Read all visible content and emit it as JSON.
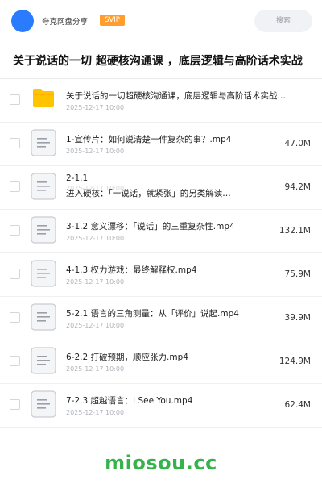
{
  "header": {
    "uploader": "夸克网盘分享",
    "badge": "SVIP",
    "search_placeholder": "搜索",
    "avatar_color": "#2b7bff"
  },
  "title": "关于说话的一切 超硬核沟通课 ，底层逻辑与高阶话术实战",
  "items": [
    {
      "type": "folder",
      "name": "关于说话的一切超硬核沟通课，底层逻辑与高阶话术实战…",
      "date": "2025-12-17 10:00",
      "size": ""
    },
    {
      "type": "file",
      "name": "1-宣传片：如何说清楚一件复杂的事？.mp4",
      "date": "2025-12-17 10:00",
      "size": "47.0M"
    },
    {
      "type": "file",
      "name": "2-1.1",
      "desc": "进入硬核：「一说话，就紧张」的另类解读…",
      "date": "2025-12-17 10:00",
      "size": "94.2M"
    },
    {
      "type": "file",
      "name": "3-1.2 意义漂移：「说话」的三重复杂性.mp4",
      "date": "2025-12-17 10:00",
      "size": "132.1M"
    },
    {
      "type": "file",
      "name": "4-1.3 权力游戏：最终解释权.mp4",
      "date": "2025-12-17 10:00",
      "size": "75.9M"
    },
    {
      "type": "file",
      "name": "5-2.1 语言的三角测量：从「评价」说起.mp4",
      "date": "2025-12-17 10:00",
      "size": "39.9M"
    },
    {
      "type": "file",
      "name": "6-2.2 打破预期，顺应张力.mp4",
      "date": "2025-12-17 10:00",
      "size": "124.9M"
    },
    {
      "type": "file",
      "name": "7-2.3 超越语言：I See You.mp4",
      "date": "2025-12-17 10:00",
      "size": "62.4M"
    }
  ],
  "watermark": "miosou.cc",
  "colors": {
    "badge": "#ff9d2e",
    "folder": "#ffc400",
    "watermark": "#34b34a"
  }
}
